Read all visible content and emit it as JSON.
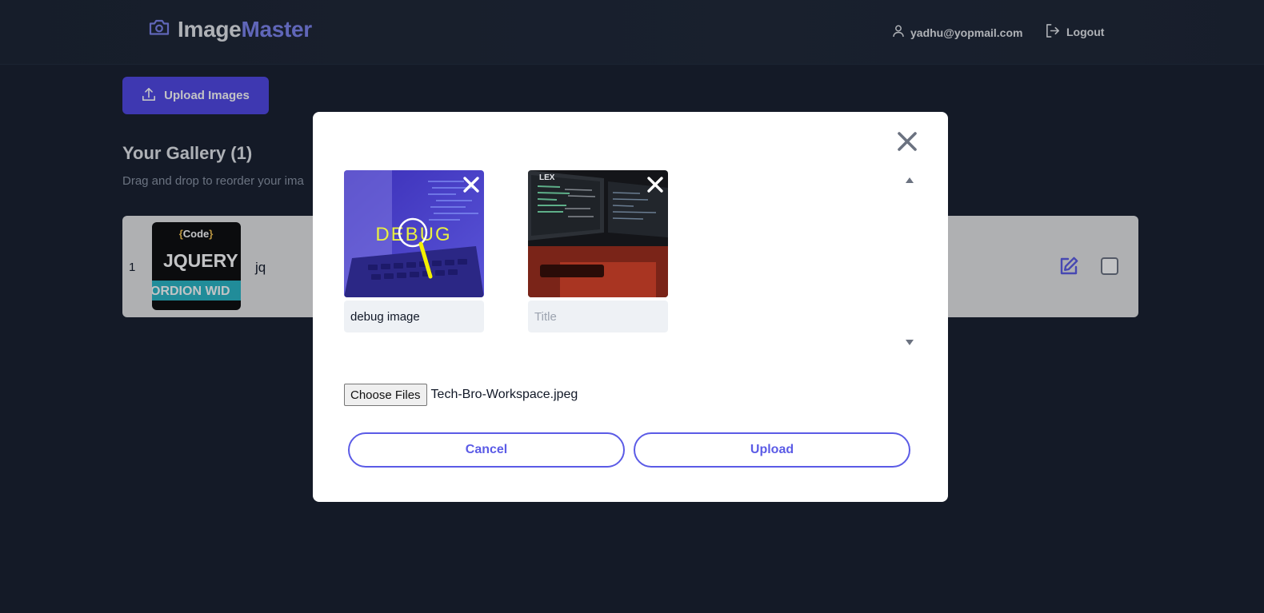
{
  "header": {
    "brand_part1": "Image",
    "brand_part2": "Master",
    "brand_icon": "camera-icon",
    "user_email": "yadhu@yopmail.com",
    "logout_label": "Logout"
  },
  "toolbar": {
    "upload_label": "Upload Images"
  },
  "gallery": {
    "title": "Your Gallery (1)",
    "hint": "Drag and drop to reorder your ima",
    "items": [
      {
        "index": "1",
        "title": "jq",
        "thumb": {
          "brand_prefix": "{",
          "brand": "Code",
          "brand_suffix": "}",
          "line1": "JQUERY",
          "line2": "ORDION WID"
        }
      }
    ]
  },
  "modal": {
    "images": [
      {
        "title_value": "debug image",
        "placeholder": "Title",
        "overlay_text": "DEBUG"
      },
      {
        "title_value": "",
        "placeholder": "Title",
        "overlay_text": "LEX"
      }
    ],
    "choose_files_label": "Choose Files",
    "file_name": "Tech-Bro-Workspace.jpeg",
    "cancel_label": "Cancel",
    "upload_label": "Upload"
  },
  "colors": {
    "accent": "#4f46e5",
    "outline": "#5b5be6",
    "background": "#171e2c"
  }
}
